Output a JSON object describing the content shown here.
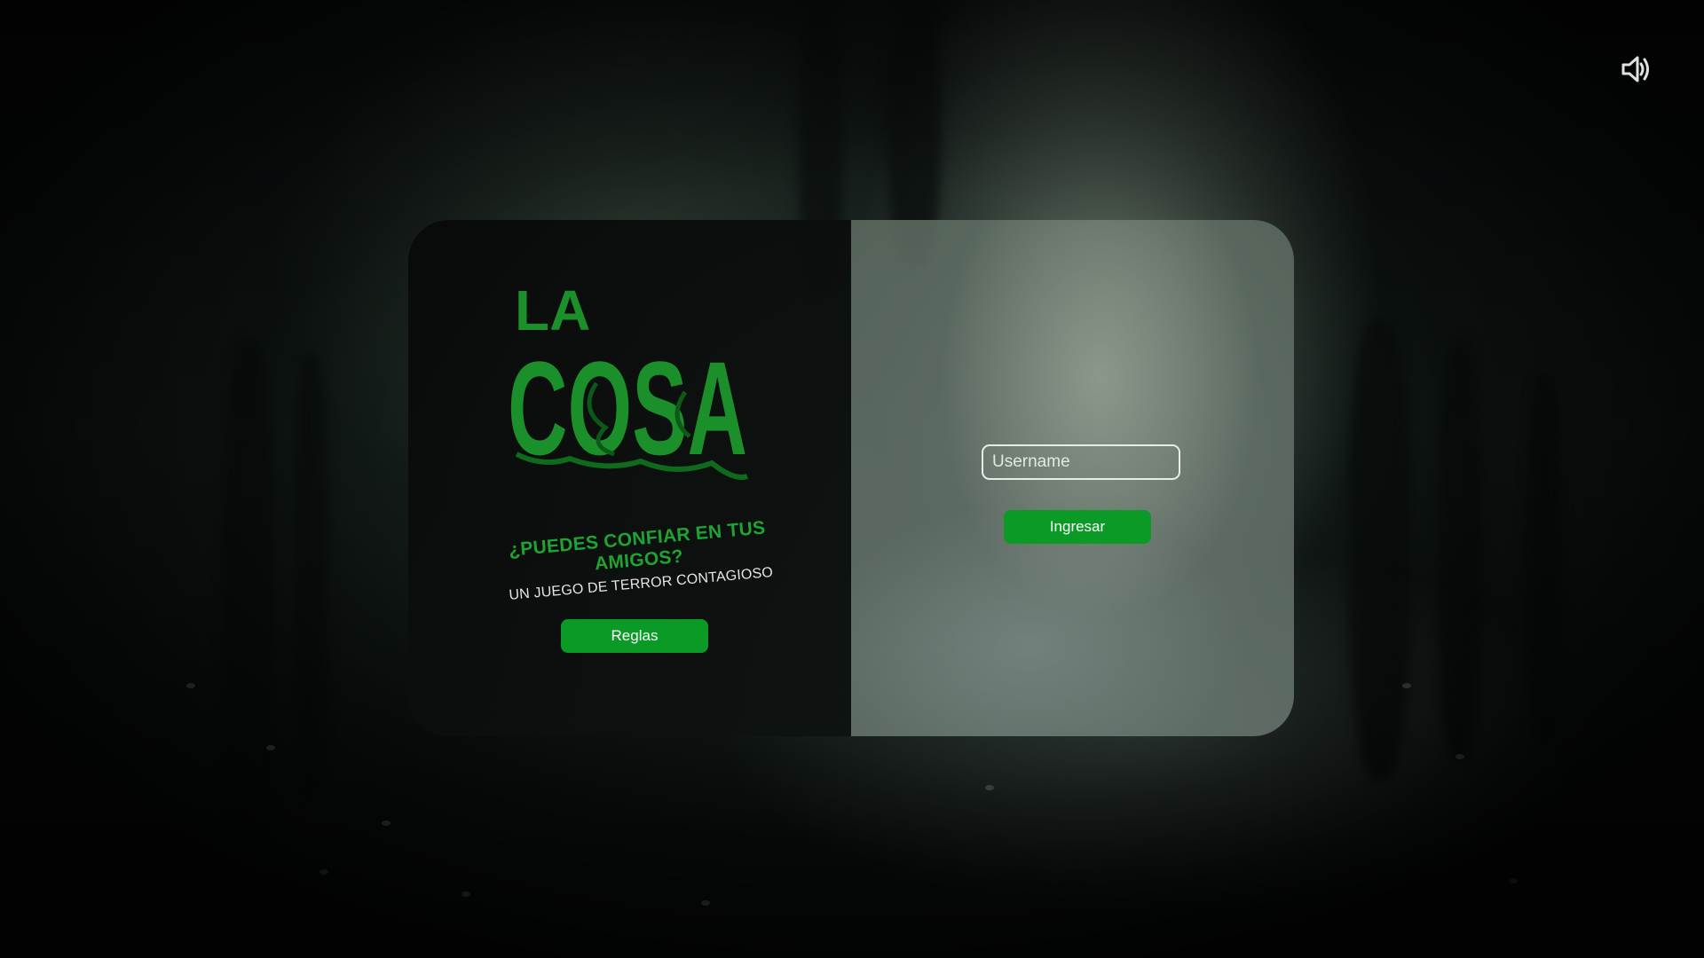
{
  "audio": {
    "icon": "speaker-volume-icon"
  },
  "logo": {
    "line1": "LA",
    "line2": "COSA"
  },
  "tagline": {
    "main": "¿PUEDES CONFIAR EN TUS AMIGOS?",
    "sub": "UN JUEGO DE TERROR CONTAGIOSO"
  },
  "rules_button": {
    "label": "Reglas"
  },
  "login": {
    "username_placeholder": "Username",
    "username_value": "",
    "submit_label": "Ingresar"
  },
  "colors": {
    "accent_green": "#0b9a25",
    "logo_green": "#1a8f2a",
    "tagline_green": "#1fa331"
  }
}
